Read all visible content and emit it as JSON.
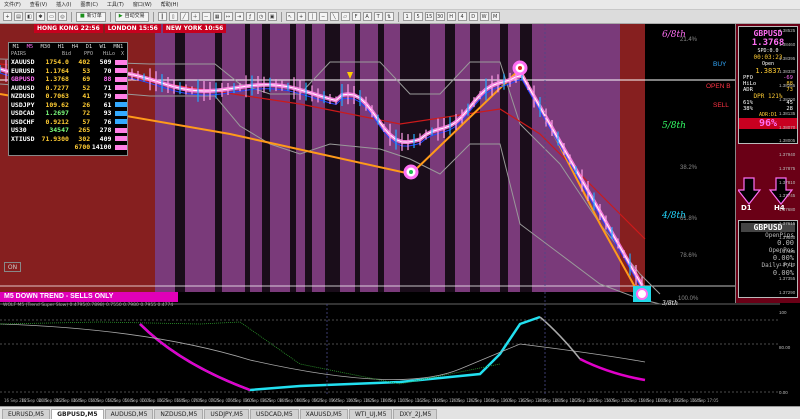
{
  "menu": [
    "文件(F)",
    "查看(V)",
    "插入(I)",
    "图表(C)",
    "工具(T)",
    "窗口(W)",
    "帮助(H)"
  ],
  "toolbar": {
    "new_order": "新订单",
    "auto_trading": "自动交易"
  },
  "sessions": [
    {
      "label": "HONG KONG 22:56"
    },
    {
      "label": "LONDON 15:56"
    },
    {
      "label": "NEW YORK 10:56"
    }
  ],
  "corr": {
    "timeframes": [
      "M1",
      "M5",
      "M30",
      "H1",
      "H4",
      "D1",
      "W1",
      "MN1"
    ],
    "headers": [
      "PAIRS",
      "Bid",
      "PFO",
      "HiLo",
      "X"
    ],
    "rows": [
      {
        "pair": "XAUUSD",
        "bid": "1754.0",
        "pfo": "402",
        "hilo": "509",
        "color": "#ffffff",
        "bar": "#ff7fe6"
      },
      {
        "pair": "EURUSD",
        "bid": "1.1764",
        "pfo": "53",
        "hilo": "70",
        "color": "#ffffff",
        "bar": "#ff7fe6"
      },
      {
        "pair": "GBPUSD",
        "bid": "1.3768",
        "pfo": "69",
        "hilo": "88",
        "color": "#ff6ef3",
        "bar": "#ff7fe6"
      },
      {
        "pair": "AUDUSD",
        "bid": "0.7277",
        "pfo": "52",
        "hilo": "71",
        "color": "#ffffff",
        "bar": "#ff7fe6"
      },
      {
        "pair": "NZDUSD",
        "bid": "0.7063",
        "pfo": "41",
        "hilo": "79",
        "color": "#ffffff",
        "bar": "#ff7fe6"
      },
      {
        "pair": "USDJPY",
        "bid": "109.62",
        "pfo": "26",
        "hilo": "61",
        "color": "#ffffff",
        "bar": "#33aaff"
      },
      {
        "pair": "USDCAD",
        "bid": "1.2697",
        "pfo": "72",
        "hilo": "93",
        "color": "#ffffff",
        "bar": "#33aaff"
      },
      {
        "pair": "USDCHF",
        "bid": "0.9212",
        "pfo": "57",
        "hilo": "76",
        "color": "#ffffff",
        "bar": "#33aaff"
      },
      {
        "pair": "US30",
        "bid": "34547",
        "pfo": "265",
        "hilo": "278",
        "color": "#ffffff",
        "bar": "#ff7fe6"
      },
      {
        "pair": "XTIUSD",
        "bid": "71.9300",
        "pfo": "302",
        "hilo": "409",
        "color": "#ffffff",
        "bar": "#ff7fe6"
      },
      {
        "pair": "",
        "bid": "",
        "pfo": "6700",
        "hilo": "14100",
        "color": "#ffffff",
        "bar": "#ff7fe6"
      }
    ]
  },
  "info": {
    "symbol": "GBPUSD",
    "price": "1.3768",
    "spd": "SPD:0.0",
    "timer": "00:03:23",
    "open_label": "Open",
    "open": "1.3837",
    "pfo": [
      "PFO",
      "-69"
    ],
    "hilo": [
      "HiLo",
      "88"
    ],
    "adr": [
      "ADR",
      "73"
    ],
    "dpr": "DPR 121%",
    "r1": [
      "61%",
      "45"
    ],
    "r2": [
      "38%",
      "28"
    ],
    "adr_tf": "ADR:D1",
    "big_pct": "96%"
  },
  "arrows": {
    "left": "D1",
    "right": "H4"
  },
  "pos": {
    "symbol": "GBPUSD",
    "open_pips_label": "OpenPips",
    "open_pips": "0.00",
    "open_pos_label": "OpenPos",
    "open_pos": "0.00%",
    "daily_label": "Daily P/L",
    "daily": "0.00%"
  },
  "fib": [
    {
      "label": "6/8th",
      "color": "#ff6ef3"
    },
    {
      "label": "5/8th",
      "color": "#33ff66"
    },
    {
      "label": "4/8th",
      "color": "#22d8ff"
    },
    {
      "label": "3/8th",
      "color": "#ffffff"
    }
  ],
  "fib_pct": [
    "21.4%",
    "38.2%",
    "61.8%",
    "78.6%",
    "100.0%"
  ],
  "side_labels": {
    "buy": "BUY",
    "open_b": "OPEN B",
    "sell": "SELL"
  },
  "trend": "M5  DOWN TREND - SELLS ONLY",
  "on_button": "ON",
  "indicator_title": "WOLF M5 (Trend Super Slow) 0.4795(0.7898) 0.7550 0.7980 0.7955 0.4774",
  "price_axis": [
    "1.38525",
    "1.38460",
    "1.38395",
    "1.38330",
    "1.38265",
    "1.38200",
    "1.38135",
    "1.38070",
    "1.38005",
    "1.37940",
    "1.37875",
    "1.37810",
    "1.37745",
    "1.37680",
    "1.37615",
    "1.37550",
    "1.37485",
    "1.37420",
    "1.37355",
    "1.37290"
  ],
  "ind_axis": [
    "100",
    "80.00",
    "0.00"
  ],
  "time_axis": [
    "16 Sep 2021",
    "16 Sep 04:05",
    "16 Sep 04:25",
    "16 Sep 04:45",
    "16 Sep 05:05",
    "16 Sep 05:25",
    "16 Sep 05:45",
    "16 Sep 06:05",
    "16 Sep 06:25",
    "16 Sep 06:45",
    "16 Sep 07:05",
    "16 Sep 07:25",
    "16 Sep 07:45",
    "16 Sep 08:05",
    "16 Sep 08:25",
    "16 Sep 08:45",
    "16 Sep 09:05",
    "16 Sep 09:25",
    "16 Sep 09:45",
    "16 Sep 10:05",
    "16 Sep 10:25",
    "16 Sep 10:45",
    "16 Sep 11:05",
    "16 Sep 11:25",
    "16 Sep 11:45",
    "16 Sep 12:05",
    "16 Sep 12:25",
    "16 Sep 12:45",
    "16 Sep 13:05",
    "16 Sep 13:25",
    "16 Sep 13:45",
    "16 Sep 14:05",
    "16 Sep 14:25",
    "16 Sep 14:45",
    "16 Sep 15:05",
    "16 Sep 15:25",
    "16 Sep 15:45",
    "16 Sep 16:05",
    "16 Sep 16:25",
    "16 Sep 16:45",
    "16 Sep 17:05"
  ],
  "tabs": [
    {
      "label": "EURUSD,M5",
      "active": false
    },
    {
      "label": "GBPUSD,M5",
      "active": true
    },
    {
      "label": "AUDUSD,M5",
      "active": false
    },
    {
      "label": "NZDUSD,M5",
      "active": false
    },
    {
      "label": "USDJPY,M5",
      "active": false
    },
    {
      "label": "USDCAD,M5",
      "active": false
    },
    {
      "label": "XAUUSD,M5",
      "active": false
    },
    {
      "label": "WTI_UJ,M5",
      "active": false
    },
    {
      "label": "DXY_2J,M5",
      "active": false
    }
  ]
}
